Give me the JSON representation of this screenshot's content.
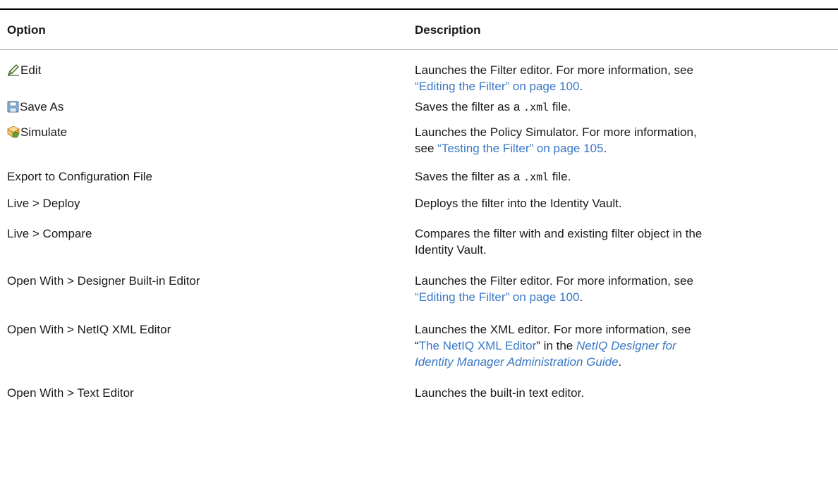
{
  "table": {
    "header": {
      "option": "Option",
      "description": "Description"
    },
    "rows": [
      {
        "option": "Edit",
        "icon": "pencil-icon",
        "desc_text": "Launches the Filter editor. For more information, see",
        "desc_link": "“Editing the Filter” on page 100",
        "desc_tail": "."
      },
      {
        "option": "Save As",
        "icon": "floppy-disk-icon",
        "desc_pre": "Saves the filter as a",
        "desc_code": ".xml",
        "desc_post": "file."
      },
      {
        "option": "Simulate",
        "icon": "simulate-icon",
        "desc_text": "Launches the Policy Simulator. For more information,",
        "desc_text2": "see",
        "desc_link": "“Testing the Filter” on page 105",
        "desc_tail": "."
      },
      {
        "option": "Export to Configuration File",
        "desc_pre": "Saves the filter as a",
        "desc_code": ".xml",
        "desc_post": "file."
      },
      {
        "option": "Live > Deploy",
        "desc_text": "Deploys the filter into the Identity Vault."
      },
      {
        "option": "Live > Compare",
        "desc_text": "Compares the filter with and existing filter object in the",
        "desc_text2": "Identity Vault."
      },
      {
        "option": "Open With > Designer Built-in Editor",
        "desc_text": "Launches the Filter editor. For more information, see",
        "desc_link": "“Editing the Filter” on page 100",
        "desc_tail": "."
      },
      {
        "option": "Open With > NetIQ XML Editor",
        "desc_text": "Launches the XML editor. For more information, see",
        "desc_quote_open": "“",
        "desc_link": "The NetIQ XML Editor",
        "desc_mid": "” in the ",
        "desc_italic_link1": "NetIQ Designer for",
        "desc_italic_link2": "Identity Manager Administration Guide",
        "desc_tail": "."
      },
      {
        "option": "Open With > Text Editor",
        "desc_text": "Launches the built-in text editor."
      }
    ]
  },
  "colors": {
    "link": "#3a77c4",
    "text": "#1a1a1a",
    "rule": "#000000"
  }
}
